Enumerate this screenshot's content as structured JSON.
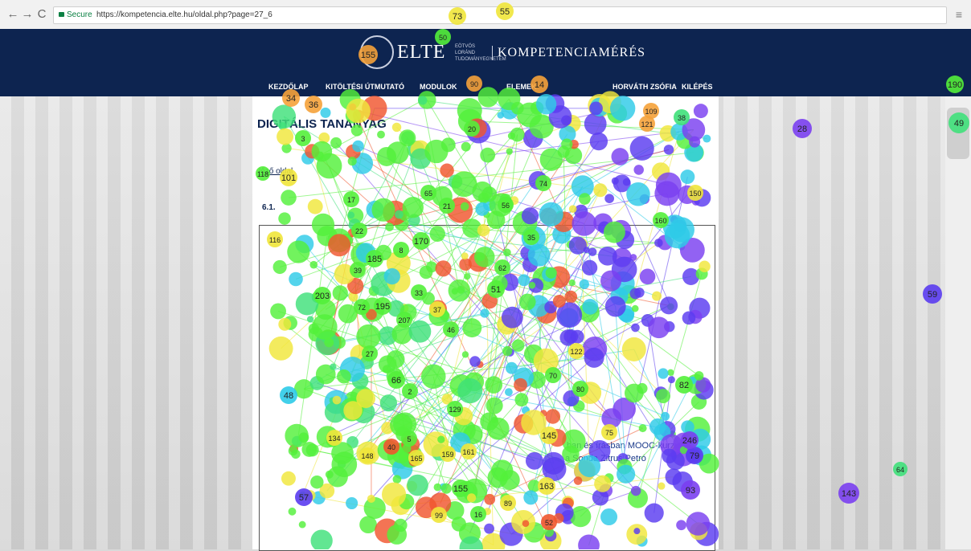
{
  "browser": {
    "back_icon": "←",
    "forward_icon": "→",
    "reload_icon": "C",
    "secure_label": "Secure",
    "url": "https://kompetencia.elte.hu/oldal.php?page=27_6",
    "menu_icon": "≡"
  },
  "header": {
    "logo_main": "ELTE",
    "logo_sub": "EÖTVÖS LORÁND TUDOMÁNYEGYETEM",
    "logo_product": "KOMPETENCIAMÉRÉS"
  },
  "nav": {
    "items": [
      "KEZDŐLAP",
      "KITÖLTÉSI ÚTMUTATÓ",
      "MODULOK",
      "ELEMEK",
      "HORVÁTH ZSÓFIA",
      "KILÉPÉS"
    ]
  },
  "page": {
    "title": "DIGITÁLIS TANANYAG",
    "back_link": "lőző oldal",
    "section": "6.1.",
    "snippet_1": "ban és írásban MOOC-kurzu",
    "snippet_2": "a Sonda Zitrus Petró"
  },
  "overlay": {
    "colors": [
      "#5a3cf0",
      "#7a3ff0",
      "#2ecbe8",
      "#3fe07a",
      "#53f03a",
      "#b6f03a",
      "#f0e63a",
      "#f5a23a",
      "#f0562e"
    ],
    "labels": [
      {
        "t": "73",
        "c": 6
      },
      {
        "t": "55",
        "c": 6
      },
      {
        "t": "50",
        "c": 4
      },
      {
        "t": "155",
        "c": 7
      },
      {
        "t": "34",
        "c": 7
      },
      {
        "t": "36",
        "c": 7
      },
      {
        "t": "3",
        "c": 4
      },
      {
        "t": "101",
        "c": 6
      },
      {
        "t": "116",
        "c": 6
      },
      {
        "t": "118",
        "c": 4
      },
      {
        "t": "20",
        "c": 4
      },
      {
        "t": "38",
        "c": 3
      },
      {
        "t": "28",
        "c": 1
      },
      {
        "t": "49",
        "c": 3
      },
      {
        "t": "190",
        "c": 4
      },
      {
        "t": "150",
        "c": 6
      },
      {
        "t": "160",
        "c": 4
      },
      {
        "t": "59",
        "c": 0
      },
      {
        "t": "143",
        "c": 1
      },
      {
        "t": "82",
        "c": 4
      },
      {
        "t": "79",
        "c": 0
      },
      {
        "t": "93",
        "c": 1
      },
      {
        "t": "48",
        "c": 2
      },
      {
        "t": "57",
        "c": 0
      },
      {
        "t": "65",
        "c": 4
      },
      {
        "t": "74",
        "c": 4
      },
      {
        "t": "170",
        "c": 4
      },
      {
        "t": "185",
        "c": 4
      },
      {
        "t": "203",
        "c": 4
      },
      {
        "t": "195",
        "c": 4
      },
      {
        "t": "66",
        "c": 4
      },
      {
        "t": "145",
        "c": 6
      },
      {
        "t": "163",
        "c": 6
      },
      {
        "t": "155",
        "c": 4
      },
      {
        "t": "64",
        "c": 3
      },
      {
        "t": "246",
        "c": 1
      },
      {
        "t": "121",
        "c": 7
      },
      {
        "t": "109",
        "c": 7
      },
      {
        "t": "14",
        "c": 7
      },
      {
        "t": "90",
        "c": 7
      },
      {
        "t": "161",
        "c": 6
      },
      {
        "t": "134",
        "c": 6
      },
      {
        "t": "22",
        "c": 4
      },
      {
        "t": "39",
        "c": 4
      },
      {
        "t": "46",
        "c": 4
      },
      {
        "t": "37",
        "c": 6
      },
      {
        "t": "51",
        "c": 4
      },
      {
        "t": "35",
        "c": 4
      },
      {
        "t": "62",
        "c": 4
      },
      {
        "t": "70",
        "c": 4
      },
      {
        "t": "80",
        "c": 4
      },
      {
        "t": "122",
        "c": 6
      },
      {
        "t": "75",
        "c": 6
      },
      {
        "t": "52",
        "c": 8
      },
      {
        "t": "89",
        "c": 6
      },
      {
        "t": "16",
        "c": 4
      },
      {
        "t": "99",
        "c": 6
      },
      {
        "t": "17",
        "c": 4
      },
      {
        "t": "21",
        "c": 4
      },
      {
        "t": "33",
        "c": 4
      },
      {
        "t": "27",
        "c": 4
      },
      {
        "t": "56",
        "c": 4
      },
      {
        "t": "8",
        "c": 4
      },
      {
        "t": "2",
        "c": 4
      },
      {
        "t": "5",
        "c": 4
      },
      {
        "t": "40",
        "c": 8
      },
      {
        "t": "159",
        "c": 6
      },
      {
        "t": "165",
        "c": 6
      },
      {
        "t": "148",
        "c": 6
      },
      {
        "t": "129",
        "c": 4
      },
      {
        "t": "207",
        "c": 4
      },
      {
        "t": "72",
        "c": 4
      }
    ]
  }
}
